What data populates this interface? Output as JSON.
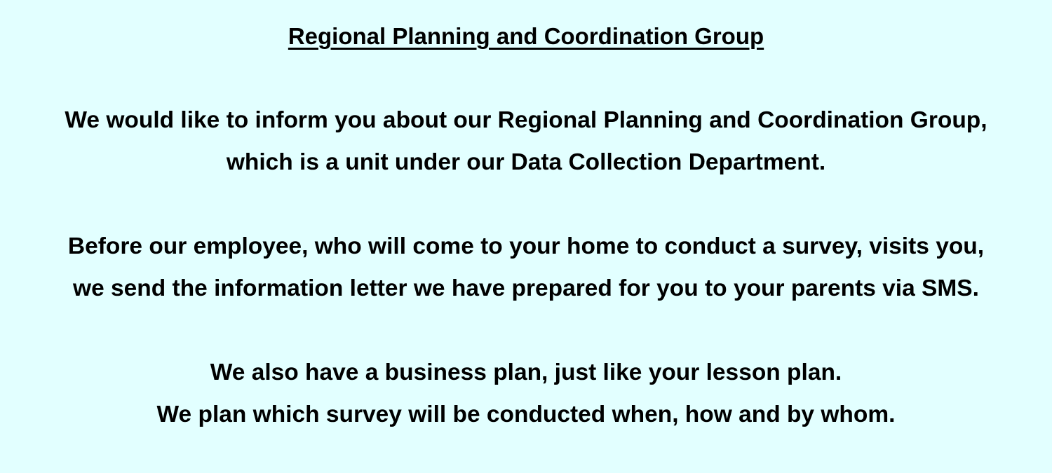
{
  "document": {
    "title": "Regional Planning and Coordination Group",
    "paragraphs": [
      {
        "lines": [
          "We would like to inform you about our Regional Planning and Coordination Group,",
          "which is a unit under our Data Collection Department."
        ]
      },
      {
        "lines": [
          "Before our employee, who will come to your home to conduct a survey, visits you,",
          "we send the information letter we have prepared for you to your parents via SMS."
        ]
      },
      {
        "lines": [
          "We also have a business plan, just like your lesson plan.",
          "We plan which survey will be conducted when, how and by whom."
        ]
      }
    ]
  },
  "colors": {
    "background": "#e2ffff",
    "text": "#000000"
  }
}
